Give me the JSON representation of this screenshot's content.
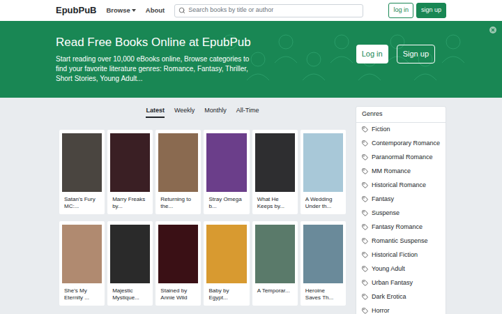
{
  "header": {
    "logo": "EpubPuB",
    "nav": [
      {
        "label": "Browse",
        "dropdown": true
      },
      {
        "label": "About",
        "dropdown": false
      }
    ],
    "search": {
      "placeholder": "Search books by title or author"
    },
    "login": "log in",
    "signup": "sign up"
  },
  "banner": {
    "title": "Read Free Books Online at EpubPub",
    "text": "Start reading over 10,000 eBooks online, Browse categories to find your favorite literature genres: Romance, Fantasy, Thriller, Short Stories, Young Adult...",
    "login": "Log in",
    "signup": "Sign up"
  },
  "tabs": [
    {
      "label": "Latest",
      "selected": true
    },
    {
      "label": "Weekly",
      "selected": false
    },
    {
      "label": "Monthly",
      "selected": false
    },
    {
      "label": "All-Time",
      "selected": false
    }
  ],
  "books": [
    {
      "title": "Satan's Fury MC:...",
      "color": "#4a4540"
    },
    {
      "title": "Marry Freaks by...",
      "color": "#3a1f24"
    },
    {
      "title": "Returning to the...",
      "color": "#8a6a50"
    },
    {
      "title": "Stray Omega b...",
      "color": "#6b3e8a"
    },
    {
      "title": "What He Keeps by...",
      "color": "#2e2e30"
    },
    {
      "title": "A Wedding Under th...",
      "color": "#a8c8d8"
    },
    {
      "title": "She's My Eternity ...",
      "color": "#b08a70"
    },
    {
      "title": "Majestic Mystique...",
      "color": "#2a2a2a"
    },
    {
      "title": "Stained by Annie Wild",
      "color": "#3a1015"
    },
    {
      "title": "Baby by Egypt...",
      "color": "#d89a30"
    },
    {
      "title": "A Temporar...",
      "color": "#5a7a6a"
    },
    {
      "title": "Heroine Saves Th...",
      "color": "#6a8a9a"
    }
  ],
  "genres": {
    "title": "Genres",
    "items": [
      "Fiction",
      "Contemporary Romance",
      "Paranormal Romance",
      "MM Romance",
      "Historical Romance",
      "Fantasy",
      "Suspense",
      "Fantasy Romance",
      "Romantic Suspense",
      "Historical Fiction",
      "Young Adult",
      "Urban Fantasy",
      "Dark Erotica",
      "Horror"
    ]
  }
}
